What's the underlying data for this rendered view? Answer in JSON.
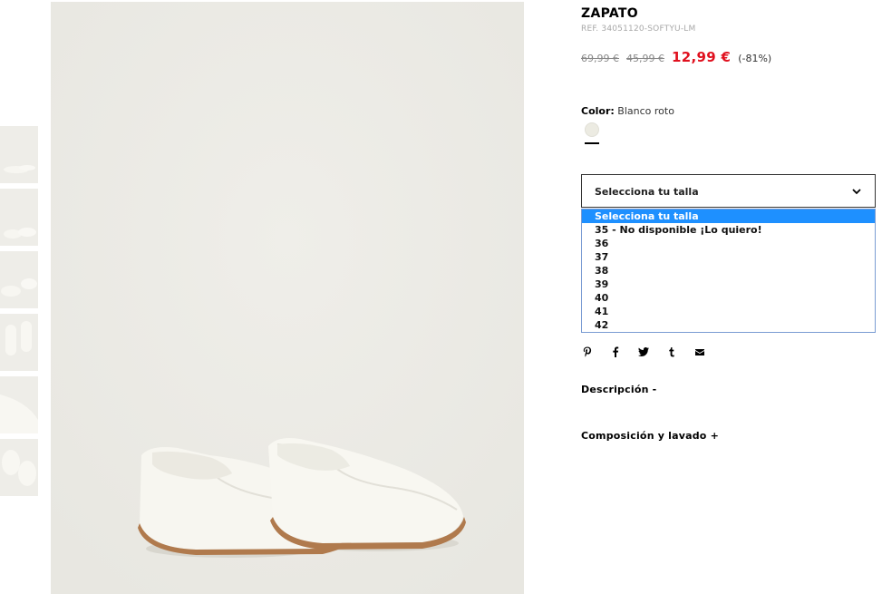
{
  "product": {
    "title": "ZAPATO",
    "ref": "REF. 34051120-SOFTYU-LM",
    "price_original": "69,99 €",
    "price_previous": "45,99 €",
    "price_current": "12,99 €",
    "discount": "(-81%)"
  },
  "color": {
    "label": "Color:",
    "value": " Blanco roto",
    "swatch_hex": "#ecebe2"
  },
  "size_select": {
    "selected": "Selecciona tu talla",
    "options": [
      "Selecciona tu talla",
      "35 - No disponible ¡Lo quiero!",
      "36",
      "37",
      "38",
      "39",
      "40",
      "41",
      "42"
    ]
  },
  "social": [
    "pinterest-icon",
    "facebook-icon",
    "twitter-icon",
    "tumblr-icon",
    "email-icon"
  ],
  "sections": {
    "description": "Descripción  -",
    "composition": "Composición y lavado  +"
  },
  "thumbnails": [
    "thumbnail-1",
    "thumbnail-2",
    "thumbnail-3",
    "thumbnail-4",
    "thumbnail-5",
    "thumbnail-6"
  ],
  "colors": {
    "accent_price": "#e0101e",
    "highlight": "#1e90ff"
  }
}
